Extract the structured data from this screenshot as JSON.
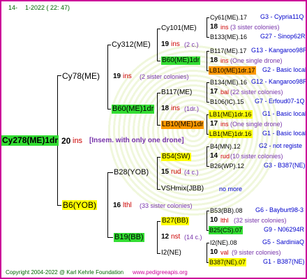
{
  "header": {
    "num": "14-",
    "date": "1-2022 ( 22: 47)"
  },
  "footer": {
    "copyright": "Copyright 2004-2022 @ Karl Kehrle Foundation",
    "site": "www.pedigreeapis.org"
  },
  "colors": {
    "border": "#cc0099",
    "green": "#33dd33",
    "yellow": "#ffff00",
    "orange": "#ff9900",
    "blue": "#0000cc",
    "red": "#cc0000",
    "purple": "#7733aa"
  },
  "g0": {
    "queen": "Cy278(ME)1dr",
    "num": "20",
    "unit": "ins",
    "note": "[Insem. with only one drone]"
  },
  "g1": [
    {
      "queen": "Cy78(ME)",
      "num": "19",
      "unit": "ins",
      "note": "(2 sister colonies)"
    },
    {
      "queen": "B6(YOB)",
      "num": "16",
      "unit": "lthl",
      "note": "(33 sister colonies)"
    }
  ],
  "g2": [
    {
      "queen": "Cy312(ME)",
      "num": "19",
      "unit": "ins",
      "note": "(2 c.)"
    },
    {
      "queen": "B60(ME)1dr",
      "num": "18",
      "unit": "ins",
      "note": "(1dr.)"
    },
    {
      "queen": "B28(YOB)",
      "num": "15",
      "unit": "rud",
      "note": "(4 c.)"
    },
    {
      "queen": "B19(BB)",
      "num": "12",
      "unit": "nst",
      "note": "(14 c.)"
    }
  ],
  "g3": [
    "Cy101(ME)",
    "B60(ME)1dr",
    "B117(ME)",
    "LB10(ME)1dr",
    "B54(SW)",
    "VSHmix(JBB)",
    "B27(BB)",
    "I2(NE)"
  ],
  "g4": [
    {
      "top": "Cy61(ME).17",
      "top_r": "G3 - Cypria11Q",
      "num": "18",
      "unit": "ins",
      "note": "(3 sister colonies)",
      "bot": "B133(ME).16",
      "bot_r": "G27 - Sinop62R"
    },
    {
      "top": "B117(ME).17",
      "top_r": "G13 - Kangaroo98R",
      "num": "18",
      "unit": "ins",
      "note": "(One single drone)",
      "bot": "LB10(ME)1dr.17",
      "bot_r": "G2 - Basic local"
    },
    {
      "top": "B134(ME).16",
      "top_r": "G12 - Kangaroo98R",
      "num": "17",
      "unit": "bal",
      "note": "(22 sister colonies)",
      "bot": "B106(IC).15",
      "bot_r": "G7 - Erfoud07-1Q"
    },
    {
      "top": "LB1(ME)1dr.16",
      "top_r": "G1 - Basic local",
      "num": "17",
      "unit": "ins",
      "note": "(One single drone)",
      "bot": "LB1(ME)1dr.16",
      "bot_r": "G1 - Basic local"
    },
    {
      "top": "B4(MN).12",
      "top_r": "G2 - not registe",
      "num": "14",
      "unit": "rud",
      "note": "(10 sister colonies)",
      "bot": "B26(WP).12",
      "bot_r": "G3 - B387(NE)"
    },
    {
      "note": "no more"
    },
    {
      "top": "B53(BB).08",
      "top_r": "G6 - Bayburt98-3",
      "num": "10",
      "unit": "lthl",
      "note": "(32 sister colonies)",
      "bot": "B25(CS).07",
      "bot_r": "G9 - N06294R"
    },
    {
      "top": "I2(NE).08",
      "top_r": "G5 - SardiniaQ",
      "num": "10",
      "unit": "val",
      "note": "(9 sister colonies)",
      "bot": "B387(NE).07",
      "bot_r": "G1 - B387(NE)"
    }
  ]
}
